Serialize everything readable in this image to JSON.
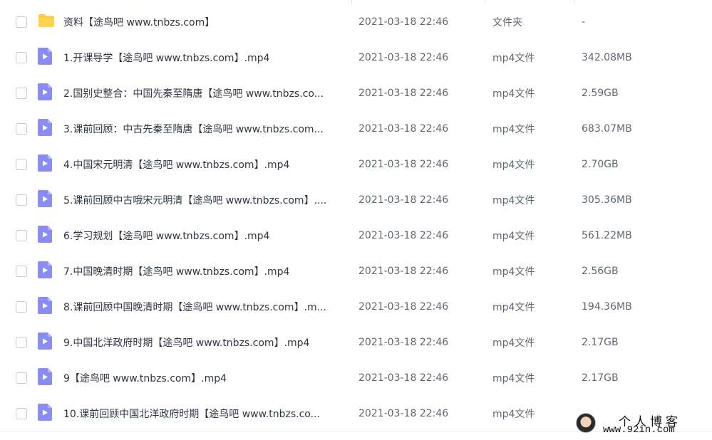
{
  "rows": [
    {
      "kind": "folder",
      "name": "资料【途鸟吧 www.tnbzs.com】",
      "date": "2021-03-18 22:46",
      "type": "文件夹",
      "size": "-"
    },
    {
      "kind": "video",
      "name": "1.开课导学【途鸟吧 www.tnbzs.com】.mp4",
      "date": "2021-03-18 22:46",
      "type": "mp4文件",
      "size": "342.08MB"
    },
    {
      "kind": "video",
      "name": "2.国别史整合：中国先秦至隋唐【途鸟吧 www.tnbzs.co...",
      "date": "2021-03-18 22:46",
      "type": "mp4文件",
      "size": "2.59GB"
    },
    {
      "kind": "video",
      "name": "3.课前回顾：中古先秦至隋唐【途鸟吧 www.tnbzs.com...",
      "date": "2021-03-18 22:46",
      "type": "mp4文件",
      "size": "683.07MB"
    },
    {
      "kind": "video",
      "name": "4.中国宋元明清【途鸟吧 www.tnbzs.com】.mp4",
      "date": "2021-03-18 22:46",
      "type": "mp4文件",
      "size": "2.70GB"
    },
    {
      "kind": "video",
      "name": "5.课前回顾中古哦宋元明清【途鸟吧 www.tnbzs.com】....",
      "date": "2021-03-18 22:46",
      "type": "mp4文件",
      "size": "305.36MB"
    },
    {
      "kind": "video",
      "name": "6.学习规划【途鸟吧 www.tnbzs.com】.mp4",
      "date": "2021-03-18 22:46",
      "type": "mp4文件",
      "size": "561.22MB"
    },
    {
      "kind": "video",
      "name": "7.中国晚清时期【途鸟吧 www.tnbzs.com】.mp4",
      "date": "2021-03-18 22:46",
      "type": "mp4文件",
      "size": "2.56GB"
    },
    {
      "kind": "video",
      "name": "8.课前回顾中国晚清时期【途鸟吧 www.tnbzs.com】.m...",
      "date": "2021-03-18 22:46",
      "type": "mp4文件",
      "size": "194.36MB"
    },
    {
      "kind": "video",
      "name": "9.中国北洋政府时期【途鸟吧 www.tnbzs.com】.mp4",
      "date": "2021-03-18 22:46",
      "type": "mp4文件",
      "size": "2.17GB"
    },
    {
      "kind": "video",
      "name": "9【途鸟吧 www.tnbzs.com】.mp4",
      "date": "2021-03-18 22:46",
      "type": "mp4文件",
      "size": "2.17GB"
    },
    {
      "kind": "video",
      "name": "10.课前回顾中国北洋政府时期【途鸟吧 www.tnbzs.co...",
      "date": "2021-03-18 22:46",
      "type": "mp4文件",
      "size": ""
    }
  ],
  "icons": {
    "folder": "folder-icon",
    "video": "video-file-icon"
  },
  "colors": {
    "folder": "#ffc83d",
    "video": "#8a8cf5"
  },
  "watermark": {
    "title": "个人博客",
    "url": "www.92in.com"
  }
}
